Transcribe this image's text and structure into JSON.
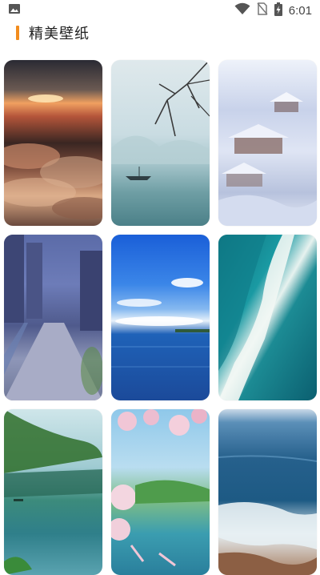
{
  "status_bar": {
    "time": "6:01",
    "icons": [
      "image-notification-icon",
      "wifi-icon",
      "no-sim-icon",
      "battery-charging-icon"
    ]
  },
  "header": {
    "title": "精美壁纸",
    "accent_color": "#f28c1e"
  },
  "wallpapers": [
    {
      "name": "wallpaper-sunset-clouds"
    },
    {
      "name": "wallpaper-ink-landscape-boat"
    },
    {
      "name": "wallpaper-snowy-palace"
    },
    {
      "name": "wallpaper-anime-street"
    },
    {
      "name": "wallpaper-blue-sea-sky"
    },
    {
      "name": "wallpaper-ocean-wave-aerial"
    },
    {
      "name": "wallpaper-lake-tree"
    },
    {
      "name": "wallpaper-cherry-blossom-lake"
    },
    {
      "name": "wallpaper-coastal-waves"
    }
  ]
}
